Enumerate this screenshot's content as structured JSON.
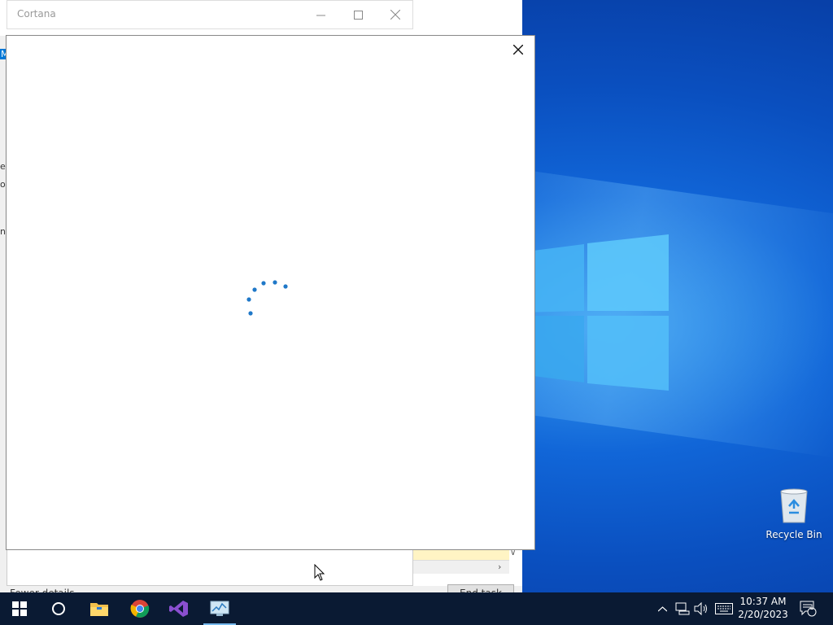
{
  "cortana": {
    "title": "Cortana",
    "minimize_icon": "minimize-icon",
    "maximize_icon": "maximize-icon",
    "close_icon": "close-icon",
    "panel_close_icon": "close-icon",
    "loading": "loading-spinner"
  },
  "task_manager": {
    "fewer_details": "Fewer details",
    "end_task": "End task",
    "left_fragments": [
      "M",
      "e",
      "o",
      "n"
    ]
  },
  "desktop": {
    "recycle_bin_label": "Recycle Bin"
  },
  "taskbar": {
    "apps": [
      {
        "name": "start",
        "icon": "windows-start-icon"
      },
      {
        "name": "cortana-search",
        "icon": "search-circle-icon"
      },
      {
        "name": "file-explorer",
        "icon": "folder-icon"
      },
      {
        "name": "chrome",
        "icon": "chrome-icon"
      },
      {
        "name": "visual-studio",
        "icon": "visual-studio-icon"
      },
      {
        "name": "task-manager",
        "icon": "task-manager-icon",
        "active": true
      }
    ],
    "clock": {
      "time": "10:37 AM",
      "date": "2/20/2023"
    },
    "notification_count": "1"
  },
  "colors": {
    "accent": "#0078d7",
    "taskbar": "#0a1a33",
    "spinner": "#1f78c8"
  }
}
